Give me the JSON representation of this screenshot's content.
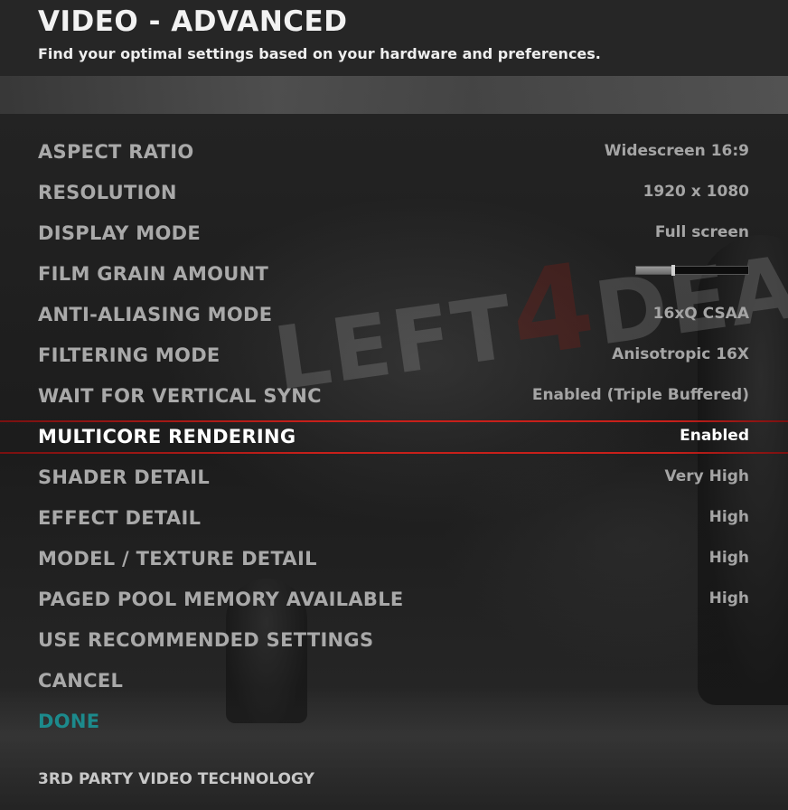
{
  "header": {
    "title": "VIDEO - ADVANCED",
    "subtitle": "Find your optimal settings based on your hardware and preferences."
  },
  "settings": [
    {
      "label": "ASPECT RATIO",
      "value": "Widescreen 16:9"
    },
    {
      "label": "RESOLUTION",
      "value": "1920 x 1080"
    },
    {
      "label": "DISPLAY MODE",
      "value": "Full screen"
    },
    {
      "label": "FILM GRAIN AMOUNT",
      "slider_fraction": 0.33
    },
    {
      "label": "ANTI-ALIASING MODE",
      "value": "16xQ CSAA"
    },
    {
      "label": "FILTERING MODE",
      "value": "Anisotropic 16X"
    },
    {
      "label": "WAIT FOR VERTICAL SYNC",
      "value": "Enabled (Triple Buffered)"
    },
    {
      "label": "MULTICORE RENDERING",
      "value": "Enabled",
      "selected": true
    },
    {
      "label": "SHADER DETAIL",
      "value": "Very High"
    },
    {
      "label": "EFFECT DETAIL",
      "value": "High"
    },
    {
      "label": "MODEL / TEXTURE DETAIL",
      "value": "High"
    },
    {
      "label": "PAGED POOL MEMORY AVAILABLE",
      "value": "High"
    }
  ],
  "actions": {
    "use_recommended": "USE RECOMMENDED SETTINGS",
    "cancel": "CANCEL",
    "done": "DONE"
  },
  "footer": {
    "third_party": "3RD PARTY VIDEO TECHNOLOGY"
  },
  "background_logo": {
    "text_left": "LEFT",
    "digit": "4",
    "text_right": "DEA"
  },
  "colors": {
    "highlight_red": "#c8201a",
    "done_teal": "#1c8a8c",
    "label_gray": "#a9a9a9"
  }
}
